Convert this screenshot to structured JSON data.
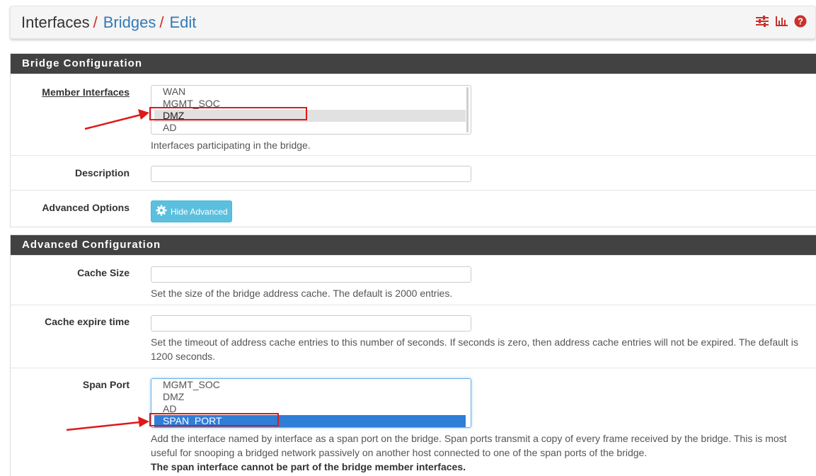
{
  "breadcrumb": {
    "items": [
      "Interfaces",
      "Bridges",
      "Edit"
    ],
    "separator": "/",
    "icons": [
      "sliders-icon",
      "bar-chart-icon",
      "help-icon"
    ]
  },
  "bridge_config": {
    "heading": "Bridge Configuration",
    "member_interfaces": {
      "label": "Member Interfaces",
      "options": [
        "WAN",
        "MGMT_SOC",
        "DMZ",
        "AD"
      ],
      "selected": "DMZ",
      "help": "Interfaces participating in the bridge."
    },
    "description": {
      "label": "Description",
      "value": ""
    },
    "advanced_options": {
      "label": "Advanced Options",
      "button_label": "Hide Advanced"
    }
  },
  "advanced_config": {
    "heading": "Advanced Configuration",
    "cache_size": {
      "label": "Cache Size",
      "value": "",
      "help": "Set the size of the bridge address cache. The default is 2000 entries."
    },
    "cache_expire": {
      "label": "Cache expire time",
      "value": "",
      "help_line1": "Set the timeout of address cache entries to this number of seconds. If seconds is zero, then address cache entries will not be expired. The default is",
      "help_line2": "1200 seconds."
    },
    "span_port": {
      "label": "Span Port",
      "options": [
        "MGMT_SOC",
        "DMZ",
        "AD",
        "SPAN_PORT"
      ],
      "selected": "SPAN_PORT",
      "help_line1": "Add the interface named by interface as a span port on the bridge. Span ports transmit a copy of every frame received by the bridge. This is most",
      "help_line2": "useful for snooping a bridged network passively on another host connected to one of the span ports of the bridge.",
      "help_bold": "The span interface cannot be part of the bridge member interfaces."
    }
  },
  "colors": {
    "panel_heading": "#424242",
    "link": "#337ab7",
    "annotation_red": "#e01818",
    "button_info": "#5bc0de",
    "selected_blue": "#2f7ed8"
  }
}
